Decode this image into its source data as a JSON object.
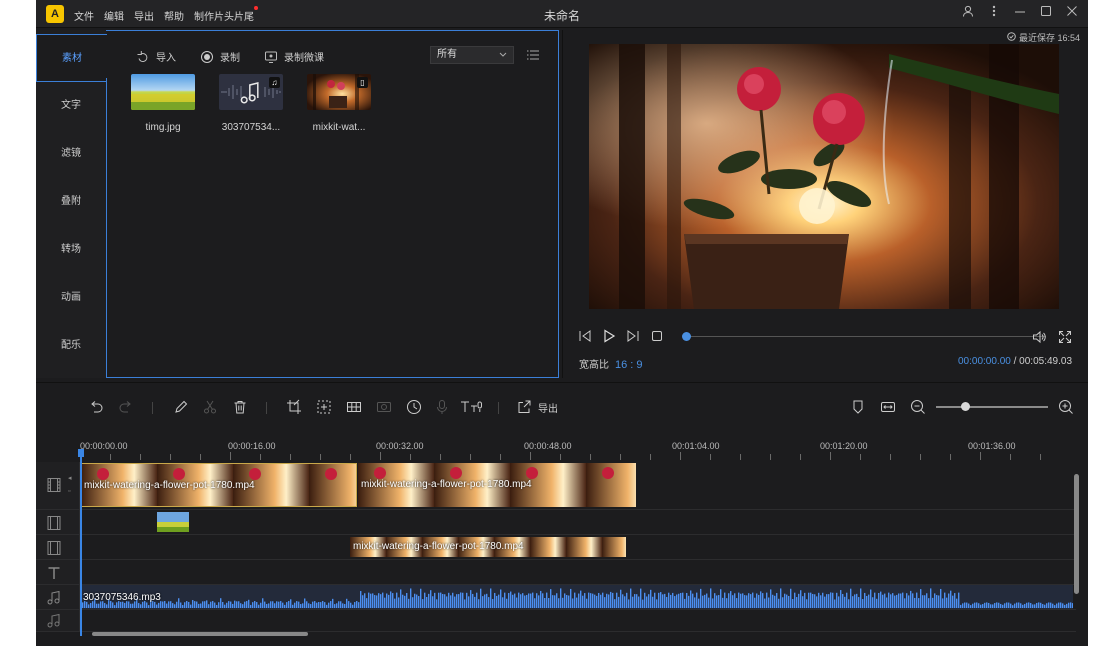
{
  "app": {
    "title": "未命名",
    "logo_text": "A",
    "menu": [
      "文件",
      "编辑",
      "导出",
      "帮助",
      "制作片头片尾"
    ],
    "window_controls": [
      "user-icon",
      "more-icon",
      "minimize-icon",
      "maximize-icon",
      "close-icon"
    ]
  },
  "sidebar": {
    "items": [
      {
        "label": "素材",
        "active": true
      },
      {
        "label": "文字",
        "active": false
      },
      {
        "label": "滤镜",
        "active": false
      },
      {
        "label": "叠附",
        "active": false
      },
      {
        "label": "转场",
        "active": false
      },
      {
        "label": "动画",
        "active": false
      },
      {
        "label": "配乐",
        "active": false
      }
    ]
  },
  "media": {
    "toolbar": {
      "import_label": "导入",
      "record_label": "录制",
      "record_micro_label": "录制微课",
      "filter_value": "所有"
    },
    "items": [
      {
        "name": "timg.jpg",
        "kind": "image"
      },
      {
        "name": "303707534...",
        "kind": "audio"
      },
      {
        "name": "mixkit-wat...",
        "kind": "video"
      }
    ]
  },
  "preview": {
    "saved_text": "最近保存 16:54",
    "aspect_label": "宽高比",
    "aspect_value": "16 : 9",
    "current_time": "00:00:00.00",
    "separator": "/",
    "total_time": "00:05:49.03",
    "progress": 0
  },
  "toolbar": {
    "export_label": "导出",
    "zoom_level": 0.25
  },
  "timeline": {
    "ruler_labels": [
      "00:00:00.00",
      "00:00:16.00",
      "00:00:32.00",
      "00:00:48.00",
      "00:01:04.00",
      "00:01:20.00",
      "00:01:36.00"
    ],
    "video_clip_1": "mixkit-watering-a-flower-pot-1780.mp4",
    "video_clip_2": "mixkit-watering-a-flower-pot-1780.mp4",
    "pip_clip": "mixkit-watering-a-flower-pot-1780.mp4",
    "audio_clip": "3037075346.mp3"
  },
  "colors": {
    "accent": "#3b7fd8",
    "timecode": "#4a90e2",
    "logo": "#f7c500",
    "background": "#1c1c1e"
  }
}
